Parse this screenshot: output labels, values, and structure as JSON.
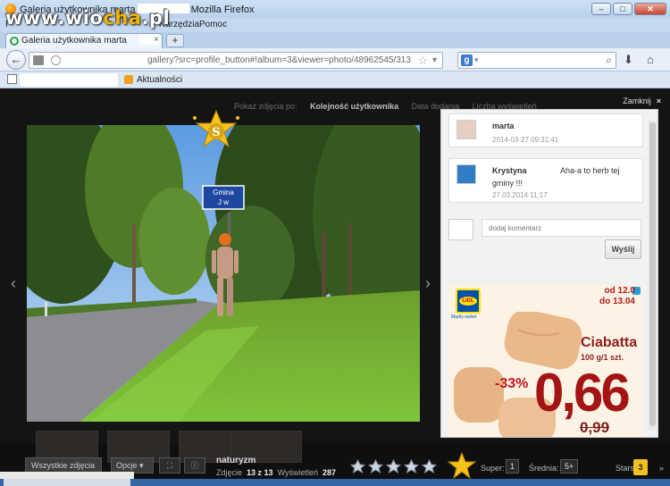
{
  "window": {
    "title_prefix": "Galeria użytkownika marta",
    "title_suffix": "Mozilla Firefox",
    "minimize": "–",
    "maximize": "□",
    "close": "✕"
  },
  "watermark": {
    "part1": "www.wio",
    "part2": "cha",
    "part3": ".pl"
  },
  "menu": {
    "item1": "P",
    "item2": "Narzędzia",
    "item3": "Pomoc"
  },
  "tab": {
    "label": "Galeria użytkownika marta",
    "close": "×",
    "new_tab": "+"
  },
  "nav": {
    "url": "gallery?src=profile_button#!album=3&viewer=photo/48962545/313",
    "search_engine_letter": "g",
    "back": "←"
  },
  "bookmarks": {
    "label": "Aktualności"
  },
  "viewer": {
    "close_label": "Zamknij",
    "close_x": "×",
    "sort": {
      "prefix": "Pokaż zdjęcia po:",
      "active": "Kolejność użytkownika",
      "option2": "Data dodania",
      "option3": "Liczba wyświetleń"
    },
    "prev_arrow": "‹",
    "next_arrow": "›",
    "sign_text_1": "Gmina",
    "sign_text_2": "J     w",
    "badge_letter": "S"
  },
  "comments": [
    {
      "author": "marta",
      "date": "2014-03-27 09:31:41"
    },
    {
      "author": "Krystyna",
      "text_1": "Aha-a to herb tej",
      "text_2": "gminy !!!",
      "date": "27.03.2014 11:17"
    }
  ],
  "add_comment": {
    "placeholder": "dodaj komentarz",
    "send": "Wyślij"
  },
  "ad": {
    "brand": "LIDL",
    "slogan": "Mądry wybór",
    "date_from": "od 12.0",
    "date_to": "do 13.04",
    "product": "Ciabatta",
    "product_sub": "100 g/1 szt.",
    "discount": "-33%",
    "price": "0,66",
    "old_price": "0,99"
  },
  "bottom": {
    "all_photos": "Wszystkie zdjęcia",
    "options": "Opcje",
    "photo_title": "naturyzm",
    "photo_label": "Zdjęcie",
    "photo_index": "13 z 13",
    "views_label": "Wyświetleń",
    "views": "287",
    "super_label": "Super:",
    "super_val": "1",
    "avg_label": "Średnia:",
    "avg_val": "5+",
    "older_label": "Starsze",
    "older_badge": "3",
    "older_arrow": "»"
  },
  "colors": {
    "accent_gold": "#f0c020",
    "lidl_blue": "#0050aa",
    "price_red": "#a31414"
  }
}
